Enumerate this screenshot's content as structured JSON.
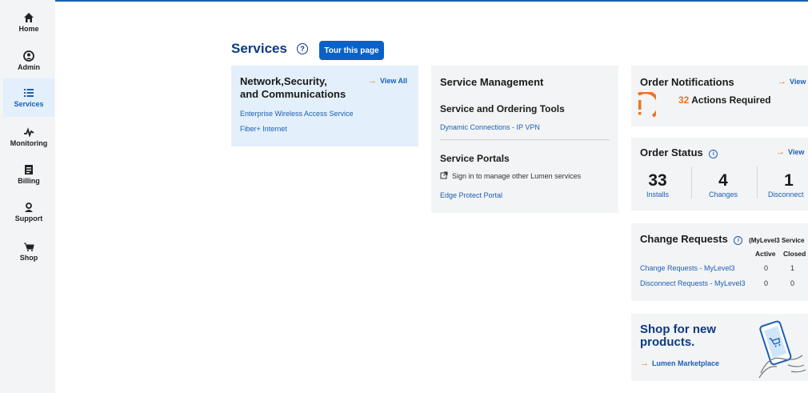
{
  "sidebar": {
    "items": [
      {
        "label": "Home",
        "icon": "home-icon"
      },
      {
        "label": "Admin",
        "icon": "user-icon"
      },
      {
        "label": "Services",
        "icon": "list-icon"
      },
      {
        "label": "Monitoring",
        "icon": "pulse-icon"
      },
      {
        "label": "Billing",
        "icon": "invoice-icon"
      },
      {
        "label": "Support",
        "icon": "support-icon"
      },
      {
        "label": "Shop",
        "icon": "cart-icon"
      }
    ],
    "active": "Services",
    "accent": "#1b5fb5"
  },
  "header": {
    "title": "Services",
    "tour_button": "Tour this page"
  },
  "network_card": {
    "title_line1": "Network,Security,",
    "title_line2": "and Communications",
    "view_all": "View All",
    "links": [
      "Enterprise Wireless Access Service",
      "Fiber+ Internet"
    ]
  },
  "service_mgmt": {
    "title": "Service Management",
    "tools_title": "Service and Ordering Tools",
    "tools_link": "Dynamic Connections - IP VPN",
    "portals_title": "Service Portals",
    "portals_note": "Sign in to manage other Lumen services",
    "portals_link": "Edge Protect Portal"
  },
  "order_notifications": {
    "title": "Order Notifications",
    "view": "View",
    "count": "32",
    "count_label": "Actions Required"
  },
  "order_status": {
    "title": "Order Status",
    "view": "View",
    "stats": [
      {
        "value": "33",
        "label": "Installs"
      },
      {
        "value": "4",
        "label": "Changes"
      },
      {
        "value": "1",
        "label": "Disconnect"
      }
    ]
  },
  "change_requests": {
    "title": "Change Requests",
    "note": "(MyLevel3 Service",
    "columns": [
      "Active",
      "Closed"
    ],
    "rows": [
      {
        "label": "Change Requests - MyLevel3",
        "active": "0",
        "closed": "1"
      },
      {
        "label": "Disconnect Requests - MyLevel3",
        "active": "0",
        "closed": "0"
      }
    ]
  },
  "shop": {
    "title_line1": "Shop for new",
    "title_line2": "products.",
    "link": "Lumen Marketplace"
  },
  "colors": {
    "brand_blue": "#0b3a82",
    "link_blue": "#1b5fb5",
    "button_blue": "#0a62c8",
    "arrow_orange": "#e87722"
  }
}
